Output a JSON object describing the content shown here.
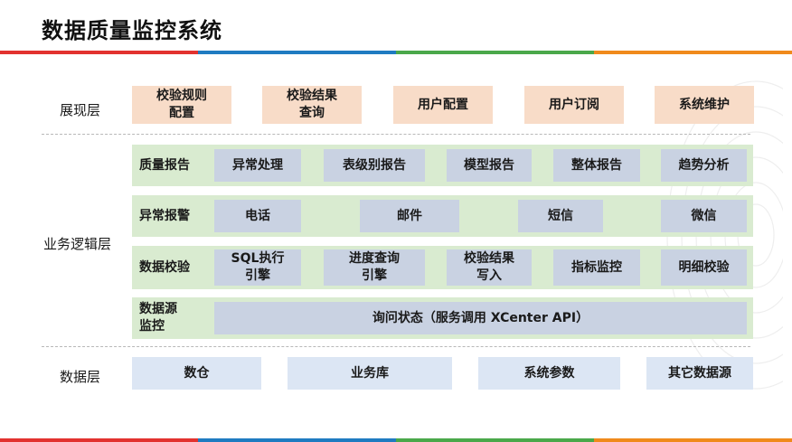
{
  "title": "数据质量监控系统",
  "colors": {
    "stripe": [
      "#e2322f",
      "#1f7bc1",
      "#4aa84a",
      "#f08a1c"
    ],
    "peach": "#f8dcc8",
    "light_blue": "#dce6f4",
    "green_row": "#d9ebd0",
    "grey_blue": "#c9d2e2"
  },
  "layers": {
    "presentation": {
      "label": "展现层",
      "items": [
        "校验规则\n配置",
        "校验结果\n查询",
        "用户配置",
        "用户订阅",
        "系统维护"
      ]
    },
    "business": {
      "label": "业务逻辑层",
      "rows": [
        {
          "label": "质量报告",
          "items": [
            "异常处理",
            "表级别报告",
            "模型报告",
            "整体报告",
            "趋势分析"
          ]
        },
        {
          "label": "异常报警",
          "items": [
            "电话",
            "邮件",
            "短信",
            "微信"
          ]
        },
        {
          "label": "数据校验",
          "items": [
            "SQL执行\n引擎",
            "进度查询\n引擎",
            "校验结果\n写入",
            "指标监控",
            "明细校验"
          ]
        },
        {
          "label": "数据源\n监控",
          "items": [
            "询问状态（服务调用 XCenter API）"
          ]
        }
      ]
    },
    "data": {
      "label": "数据层",
      "items": [
        "数仓",
        "业务库",
        "系统参数",
        "其它数据源"
      ]
    }
  }
}
